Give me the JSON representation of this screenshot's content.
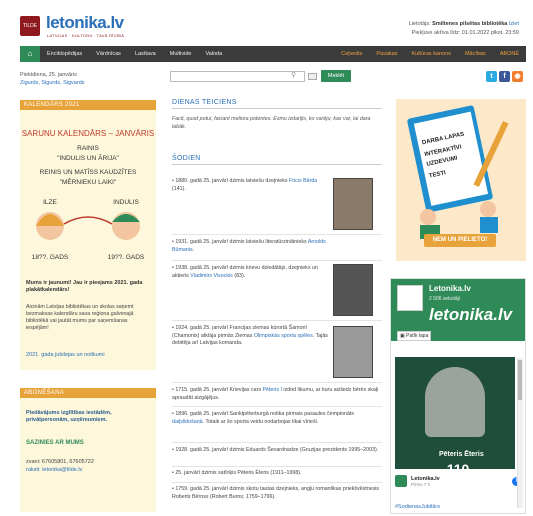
{
  "header": {
    "logo_box": "TILDE",
    "logo_text": "letonika.lv",
    "logo_sub": "LATVIJAS · KULTŪRA · TAVĀ RĪCĪBĀ",
    "user_label": "Lietotājs:",
    "user_name": "Smiltenes pilsētas bibliotēka",
    "user_exit": "Iziet",
    "sub_line": "Piekļuve aktīva līdz: 01.01.2022 plkst. 23:59"
  },
  "nav": {
    "items": [
      "Enciklopēdijas",
      "Vārdnīcas",
      "Lasītava",
      "Multivide",
      "Valoda"
    ],
    "right_items": [
      "Ceļvedis",
      "Pasakas",
      "Kultūras kanons",
      "Mācības",
      "ABONĒ"
    ]
  },
  "subheader": {
    "date": "Piektdiena, 25. janvāris",
    "names": "Zigurds, Sigurds, Sigvards",
    "search_placeholder": "",
    "search_button": "Meklēt"
  },
  "left": {
    "calendar_head": "KALENDĀRS 2021",
    "illus_title": "SARUNU KALENDĀRS – JANVĀRIS",
    "illus_l1": "RAINIS",
    "illus_l2": "\"INDULIS UN ĀRIJA\"",
    "illus_l3": "REINIS UN MATĪSS KAUDZĪTES",
    "illus_l4": "\"MĒRNIEKU LAIKI\"",
    "illus_left_name": "ILZE",
    "illus_right_name": "INDULIS",
    "illus_left_year": "18??. GADS",
    "illus_right_year": "19??. GADS",
    "question": "Mums ir jaunumi! Jau ir pieejams 2021. gada plakātkalendārs!",
    "body": "Aicinām Latvijas bibliotēkas un skolas saņemt bezmaksas kalendāru sava reģiona galvenajā bibliotēkā vai jautāt mums par saņemšanas iespējām!",
    "link": "2021. gada jubilejas un notikumi",
    "abon_head": "ABONĒŠANA",
    "abon_desc": "Piedāvājums izglītības iestādēm, privātpersonām, uzņēmumiem.",
    "contact_head": "SAZINIES AR MUMS",
    "phone": "zvani: 67605801, 67605722",
    "email": "raksti: letonika@tilde.lv"
  },
  "middle": {
    "thought_head": "DIENAS TEICIENS",
    "quote": "Facit, quod potui, faciant meliora potentes. Esmu izdarījis, ko varēju; kas var, lai dara labāk.",
    "today_head": "ŠODIEN",
    "events": [
      {
        "text": "1880. gadā 25. janvārī dzimis latviešu dzejnieks ",
        "link": "Fricis Bārda",
        "tail": " (141)."
      },
      {
        "text": "1931. gadā 25. janvārī dzimis latviešu literatūrzinātnieks ",
        "link": "Arnolds Būmanis",
        "tail": "."
      },
      {
        "text": "1938. gadā 25. janvārī dzimis krievu dziedātājs, dzejnieks un aktieris ",
        "link": "Vladimirs Visockis",
        "tail": " (83)."
      },
      {
        "text": "1924. gadā 25. janvārī Francijas ziemas kūrortā Šamonī (Chamonix) atklāja pirmās Ziemas ",
        "link": "Olimpiskās sporta spēles",
        "tail": ". Tajās debitēja arī Latvijas komanda."
      },
      {
        "text": "1715. gadā 25. janvārī Krievijas cars ",
        "link": "Pēteris I",
        "tail": " izdod likumu, ar kuru aizliedz bērēs skaļi apraudāt aizgājējus."
      },
      {
        "text": "1896. gadā 25. janvārī Sanktpēterburgā notika pirmais pasaules čempionāts ",
        "link": "daiļslidošanā",
        "tail": ". Totaik ar šo sporta veidu nodarbojas tikai vīrieši."
      },
      {
        "text": "1928. gadā 25. janvārī dzimis Eduards Ševardnadze (Gruzijas prezidents 1995–2003).",
        "link": "",
        "tail": ""
      },
      {
        "text": "25. janvārī dzimis satīriķis Pēteris Ēteris (1911–1998).",
        "link": "",
        "tail": ""
      },
      {
        "text": "1759. gadā 25. janvārī dzimis skotu tautas dzejnieks, angļu romantikas priekšvēstnesis Roberts Bērnss (Robert Burns; 1759–1796).",
        "link": "",
        "tail": ""
      }
    ]
  },
  "right": {
    "ad_l1": "DARBA LAPAS",
    "ad_l2": "INTERAKTĪVI",
    "ad_l3": "UZDEVUMI",
    "ad_l4": "TESTI",
    "ad_button": "ŅEM UN PIELIETO!",
    "fb_name": "Letonika.lv",
    "fb_likes": "2 506 sekotāji",
    "fb_big": "letonika.lv",
    "fb_like": "Patīk lapa",
    "fb_post_person": "Pēteris Ēteris",
    "fb_post_num": "110",
    "fb_post_author": "Letonika.lv",
    "fb_post_time": "Pirms 7 h",
    "fb_tag": "#SodienasJubilārs"
  },
  "colors": {
    "accent": "#2e8b57",
    "orange": "#e8a23a",
    "nav": "#3b3b3b",
    "link": "#2a6fb8",
    "brand": "#8e1a1f"
  }
}
